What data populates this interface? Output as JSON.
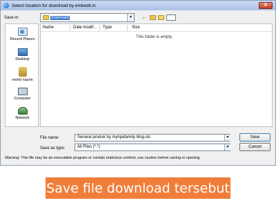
{
  "dialog": {
    "title": "Select location for download by embedit.in",
    "close_label": "X",
    "save_in_label": "Save in:",
    "save_in_value": "download",
    "toolbar": {
      "back_icon": "back-arrow-icon",
      "up_icon": "up-folder-icon",
      "new_folder_icon": "new-folder-icon",
      "views_icon": "views-menu-icon"
    },
    "places": [
      {
        "label": "Recent Places",
        "icon": "recent-places-icon"
      },
      {
        "label": "Desktop",
        "icon": "desktop-icon"
      },
      {
        "label": "mohd nazrin",
        "icon": "user-folder-icon"
      },
      {
        "label": "Computer",
        "icon": "computer-icon"
      },
      {
        "label": "Network",
        "icon": "network-icon"
      }
    ],
    "columns": [
      "Name",
      "Date modif...",
      "Type",
      "Size"
    ],
    "empty_message": "This folder is empty.",
    "file_name_label": "File name:",
    "file_name_value": "Senarai produk by myhpafamily blog.xls",
    "save_as_type_label": "Save as type:",
    "save_as_type_value": "All Files (*.*)",
    "save_button": "Save",
    "cancel_button": "Cancel",
    "warning": "Warning: This file may be an executable program or contain malicious content, use caution before saving or opening."
  },
  "caption": "Save file download tersebut",
  "colors": {
    "caption_bg": "#f07e3a",
    "selection": "#3471c9"
  }
}
